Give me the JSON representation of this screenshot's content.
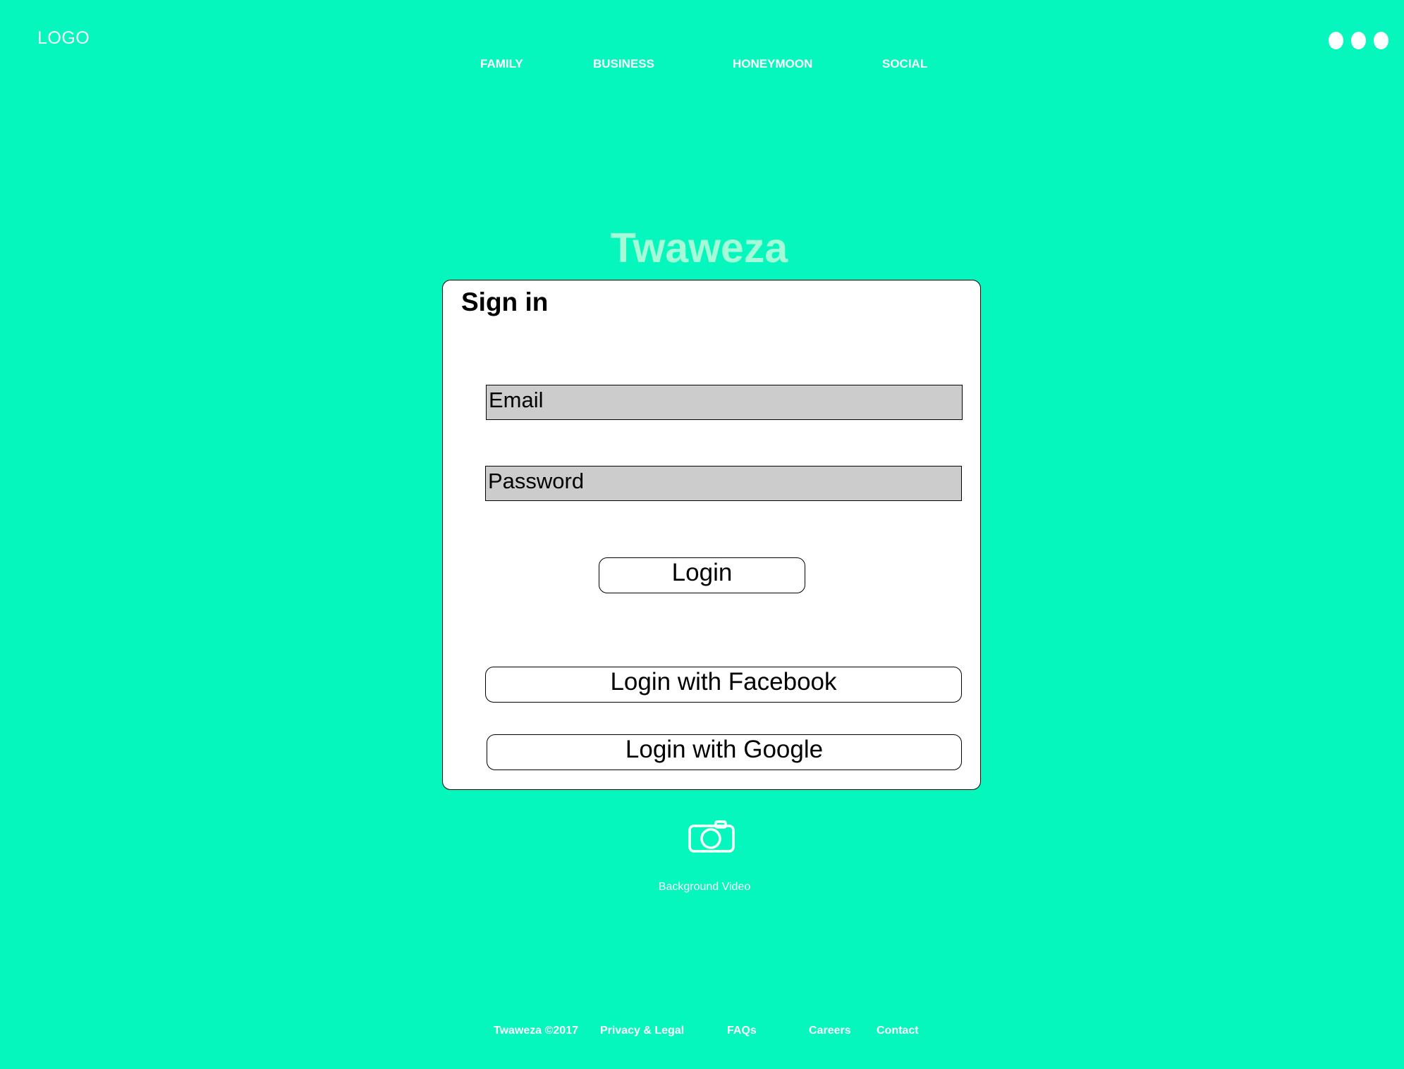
{
  "header": {
    "logo": "LOGO",
    "nav": [
      "FAMILY",
      "BUSINESS",
      "HONEYMOON",
      "SOCIAL"
    ]
  },
  "brand": "Twaweza",
  "signin": {
    "title": "Sign in",
    "email_placeholder": "Email",
    "password_placeholder": "Password",
    "login_label": "Login",
    "facebook_label": "Login with Facebook",
    "google_label": "Login with Google"
  },
  "media": {
    "icon": "camera-icon",
    "label": "Background Video"
  },
  "footer": {
    "items": [
      "Twaweza ©2017",
      "Privacy & Legal",
      "FAQs",
      "Careers",
      "Contact"
    ]
  },
  "colors": {
    "background": "#06f7bd",
    "brand_text": "#a5fbd8",
    "field_fill": "#cccccc"
  }
}
